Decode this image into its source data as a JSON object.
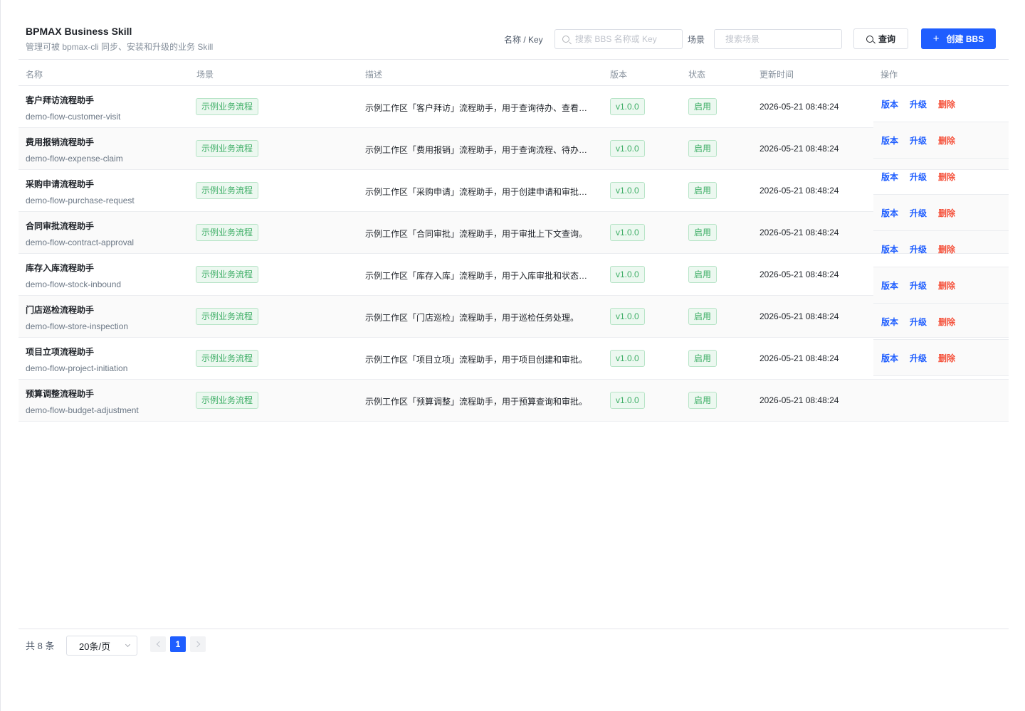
{
  "header": {
    "title": "BPMAX Business Skill",
    "subtitle": "管理可被 bpmax-cli 同步、安装和升级的业务 Skill",
    "filter_name_label": "名称 / Key",
    "search_placeholder": "搜索 BBS 名称或 Key",
    "filter_scene_label": "场景",
    "scene_placeholder": "搜索场景",
    "query_label": "查询",
    "create_label": "创建 BBS"
  },
  "table": {
    "columns": {
      "name": "名称",
      "scene": "场景",
      "desc": "描述",
      "version": "版本",
      "status": "状态",
      "updated": "更新时间",
      "actions": "操作"
    },
    "rows": [
      {
        "name": "客户拜访流程助手",
        "key": "demo-flow-customer-visit",
        "scene": "示例业务流程",
        "desc": "示例工作区「客户拜访」流程助手，用于查询待办、查看…",
        "version": "v1.0.0",
        "status": "启用",
        "updated": "2026-05-21 08:48:24"
      },
      {
        "name": "费用报销流程助手",
        "key": "demo-flow-expense-claim",
        "scene": "示例业务流程",
        "desc": "示例工作区「费用报销」流程助手，用于查询流程、待办…",
        "version": "v1.0.0",
        "status": "启用",
        "updated": "2026-05-21 08:48:24"
      },
      {
        "name": "采购申请流程助手",
        "key": "demo-flow-purchase-request",
        "scene": "示例业务流程",
        "desc": "示例工作区「采购申请」流程助手，用于创建申请和审批…",
        "version": "v1.0.0",
        "status": "启用",
        "updated": "2026-05-21 08:48:24"
      },
      {
        "name": "合同审批流程助手",
        "key": "demo-flow-contract-approval",
        "scene": "示例业务流程",
        "desc": "示例工作区「合同审批」流程助手，用于审批上下文查询。",
        "version": "v1.0.0",
        "status": "启用",
        "updated": "2026-05-21 08:48:24"
      },
      {
        "name": "库存入库流程助手",
        "key": "demo-flow-stock-inbound",
        "scene": "示例业务流程",
        "desc": "示例工作区「库存入库」流程助手，用于入库审批和状态…",
        "version": "v1.0.0",
        "status": "启用",
        "updated": "2026-05-21 08:48:24"
      },
      {
        "name": "门店巡检流程助手",
        "key": "demo-flow-store-inspection",
        "scene": "示例业务流程",
        "desc": "示例工作区「门店巡检」流程助手，用于巡检任务处理。",
        "version": "v1.0.0",
        "status": "启用",
        "updated": "2026-05-21 08:48:24"
      },
      {
        "name": "项目立项流程助手",
        "key": "demo-flow-project-initiation",
        "scene": "示例业务流程",
        "desc": "示例工作区「项目立项」流程助手，用于项目创建和审批。",
        "version": "v1.0.0",
        "status": "启用",
        "updated": "2026-05-21 08:48:24"
      },
      {
        "name": "预算调整流程助手",
        "key": "demo-flow-budget-adjustment",
        "scene": "示例业务流程",
        "desc": "示例工作区「预算调整」流程助手，用于预算查询和审批。",
        "version": "v1.0.0",
        "status": "启用",
        "updated": "2026-05-21 08:48:24"
      }
    ],
    "action_rows": [
      {
        "version": "版本",
        "upgrade": "升级",
        "delete": "删除"
      },
      {
        "version": "版本",
        "upgrade": "升级",
        "delete": "删除"
      },
      {
        "version": "版本",
        "upgrade": "升级",
        "delete": "删除"
      },
      {
        "version": "版本",
        "upgrade": "升级",
        "delete": "删除"
      },
      {
        "version": "版本",
        "upgrade": "升级",
        "delete": "删除"
      },
      {
        "version": "版本",
        "upgrade": "升级",
        "delete": "删除"
      },
      {
        "version": "版本",
        "upgrade": "升级",
        "delete": "删除"
      },
      {
        "version": "版本",
        "upgrade": "升级",
        "delete": "删除"
      }
    ]
  },
  "pagination": {
    "total": "共 8 条",
    "page_size": "20条/页",
    "current_page": "1"
  },
  "colors": {
    "primary": "#1f5eff",
    "danger": "#f5533d",
    "success_text": "#3eae66",
    "success_bg": "#ecf8f0"
  }
}
